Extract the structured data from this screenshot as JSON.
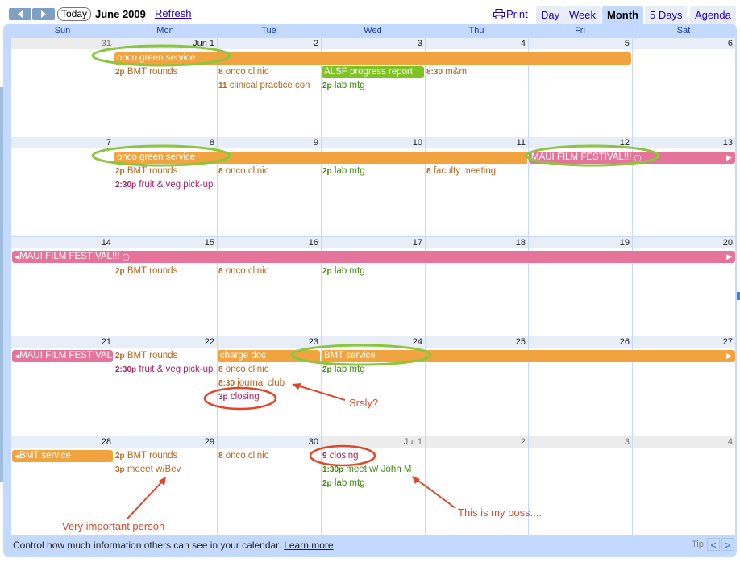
{
  "toolbar": {
    "prev_label": "previous",
    "next_label": "next",
    "today_label": "Today",
    "month_title": "June 2009",
    "refresh_label": "Refresh",
    "print_label": "Print",
    "tabs": [
      {
        "label": "Day",
        "active": false
      },
      {
        "label": "Week",
        "active": false
      },
      {
        "label": "Month",
        "active": true
      },
      {
        "label": "5 Days",
        "active": false
      },
      {
        "label": "Agenda",
        "active": false
      }
    ]
  },
  "calendar": {
    "days_of_week": [
      "Sun",
      "Mon",
      "Tue",
      "Wed",
      "Thu",
      "Fri",
      "Sat"
    ],
    "weeks": [
      {
        "dates": [
          "31",
          "Jun 1",
          "2",
          "3",
          "4",
          "5",
          "6"
        ]
      },
      {
        "dates": [
          "7",
          "8",
          "9",
          "10",
          "11",
          "12",
          "13"
        ]
      },
      {
        "dates": [
          "14",
          "15",
          "16",
          "17",
          "18",
          "19",
          "20"
        ]
      },
      {
        "dates": [
          "21",
          "22",
          "23",
          "24",
          "25",
          "26",
          "27"
        ]
      },
      {
        "dates": [
          "28",
          "29",
          "30",
          "Jul 1",
          "2",
          "3",
          "4"
        ]
      }
    ],
    "bars": {
      "w0_onco": "onco green service",
      "w0_alsf": "ALSF progress report",
      "w1_onco": "onco green service",
      "w1_maui": "MAUI FILM FESTIVAL!!!",
      "w2_maui": "MAUI FILM FESTIVAL!!!",
      "w3_maui": "MAUI FILM FESTIVAL!!!",
      "w3_charge": "charge doc",
      "w3_bmt": "BMT service",
      "w4_bmt": "BMT service"
    },
    "events": {
      "w0_mon_1": {
        "time": "2p",
        "title": "BMT rounds"
      },
      "w0_tue_1": {
        "time": "8",
        "title": "onco clinic"
      },
      "w0_tue_2": {
        "time": "11",
        "title": "clinical practice con"
      },
      "w0_wed_2": {
        "time": "2p",
        "title": "lab mtg"
      },
      "w0_thu_1": {
        "time": "8:30",
        "title": "m&m"
      },
      "w1_mon_1": {
        "time": "2p",
        "title": "BMT rounds"
      },
      "w1_mon_2": {
        "time": "2:30p",
        "title": "fruit & veg pick-up"
      },
      "w1_tue_1": {
        "time": "8",
        "title": "onco clinic"
      },
      "w1_wed_1": {
        "time": "2p",
        "title": "lab mtg"
      },
      "w1_thu_1": {
        "time": "8",
        "title": "faculty meeting"
      },
      "w2_mon_1": {
        "time": "2p",
        "title": "BMT rounds"
      },
      "w2_tue_1": {
        "time": "8",
        "title": "onco clinic"
      },
      "w2_wed_1": {
        "time": "2p",
        "title": "lab mtg"
      },
      "w3_mon_1": {
        "time": "2p",
        "title": "BMT rounds"
      },
      "w3_mon_2": {
        "time": "2:30p",
        "title": "fruit & veg pick-up"
      },
      "w3_tue_2": {
        "time": "8",
        "title": "onco clinic"
      },
      "w3_tue_3": {
        "time": "8:30",
        "title": "journal club"
      },
      "w3_tue_4": {
        "time": "3p",
        "title": "closing"
      },
      "w3_wed_2": {
        "time": "2p",
        "title": "lab mtg"
      },
      "w4_mon_1": {
        "time": "2p",
        "title": "BMT rounds"
      },
      "w4_mon_2": {
        "time": "3p",
        "title": "meeet w/Bev"
      },
      "w4_tue_1": {
        "time": "8",
        "title": "onco clinic"
      },
      "w4_wed_1": {
        "time": "9",
        "title": "closing"
      },
      "w4_wed_2": {
        "time": "1:30p",
        "title": "meet w/ John M"
      },
      "w4_wed_3": {
        "time": "2p",
        "title": "lab mtg"
      }
    }
  },
  "annotations": {
    "srsly": "Srsly?",
    "vip": "Very important person",
    "boss": "This is my boss...."
  },
  "footer": {
    "text": "Control how much information others can see in your calendar.",
    "link": "Learn more",
    "tip_label": "Tip",
    "tip_prev": "<",
    "tip_next": ">"
  },
  "colors": {
    "orange_bar": "#f0a33f",
    "pink_bar": "#e67399",
    "green_bar": "#7ec225",
    "frame": "#c3d9ff",
    "annotation_red": "#e3452b",
    "highlight_green": "#8cc63e"
  }
}
